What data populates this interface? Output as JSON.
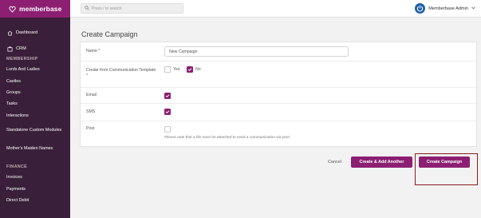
{
  "brand": {
    "name": "memberbase"
  },
  "search": {
    "placeholder": "Press / to search"
  },
  "user": {
    "name": "Memberbase Admin"
  },
  "sidebar": {
    "top_items": [
      {
        "label": "Dashboard",
        "icon": "home-icon"
      },
      {
        "label": "CRM",
        "icon": "crm-icon"
      }
    ],
    "membership_heading": "MEMBERSHIP",
    "membership_items": [
      "Lords And Ladies",
      "Castles",
      "Groups",
      "Tasks",
      "Interactions",
      "Standalone Custom Modules",
      "Mother's Maiden Names"
    ],
    "finance_heading": "FINANCE",
    "finance_items": [
      "Invoices",
      "Payments",
      "Direct Debit"
    ]
  },
  "page": {
    "title": "Create Campaign"
  },
  "form": {
    "name_label": "Name",
    "name_required": "*",
    "name_value": "New Campaign",
    "template_label": "Create from Communication Template",
    "template_required": "*",
    "template_yes": "Yes",
    "template_no": "No",
    "template_selected": "No",
    "email_label": "Email",
    "email_checked": true,
    "sms_label": "SMS",
    "sms_checked": true,
    "post_label": "Post",
    "post_checked": false,
    "post_note": "Please note that a file must be attached to send a communication via post"
  },
  "actions": {
    "cancel": "Cancel",
    "create_another": "Create & Add Another",
    "create": "Create Campaign"
  },
  "colors": {
    "accent": "#8c1f72",
    "sidebar": "#3a1f3a",
    "avatar": "#1f5fa6"
  }
}
